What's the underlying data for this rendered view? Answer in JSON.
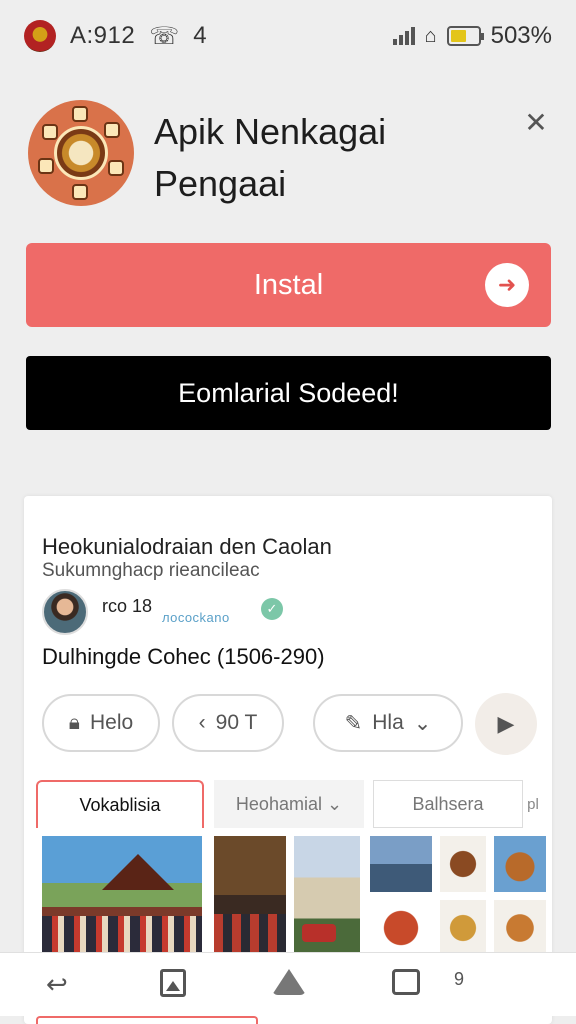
{
  "status_bar": {
    "time": "A:912",
    "call_icon": "☏",
    "extra": "4",
    "battery_percent": "503%",
    "battery_level": 0.6
  },
  "header": {
    "app_name_line1": "Apik Nenkagai",
    "app_name_line2": "Pengaai",
    "close_glyph": "✕"
  },
  "actions": {
    "install_label": "Instal",
    "install_arrow": "➜",
    "secondary_label": "Eomlarial Sodeed!"
  },
  "card": {
    "title": "Heokunialodraian den Caolan",
    "subtitle": "Sukumnghacp rieancileac",
    "author_name": "rco 18",
    "author_handle": "лocockano",
    "verified_glyph": "✓",
    "body": "Dulhingde Cohec (1506-290)",
    "pills": {
      "lock_label": "Helo",
      "time_prefix": "‹",
      "time_label": "90 T",
      "lang_label": "Hla",
      "chevron": "⌄",
      "play_glyph": "▶"
    },
    "tabs": [
      "Vokablisia",
      "Heohamial ⌄",
      "Balhsera",
      "pl"
    ]
  },
  "bottom_nav": {
    "back_glyph": "↩",
    "count": "9"
  },
  "colors": {
    "install": "#ef6a68",
    "secondary": "#000000",
    "accent_tab": "#ef6a68",
    "verified": "#7cc7a8"
  }
}
